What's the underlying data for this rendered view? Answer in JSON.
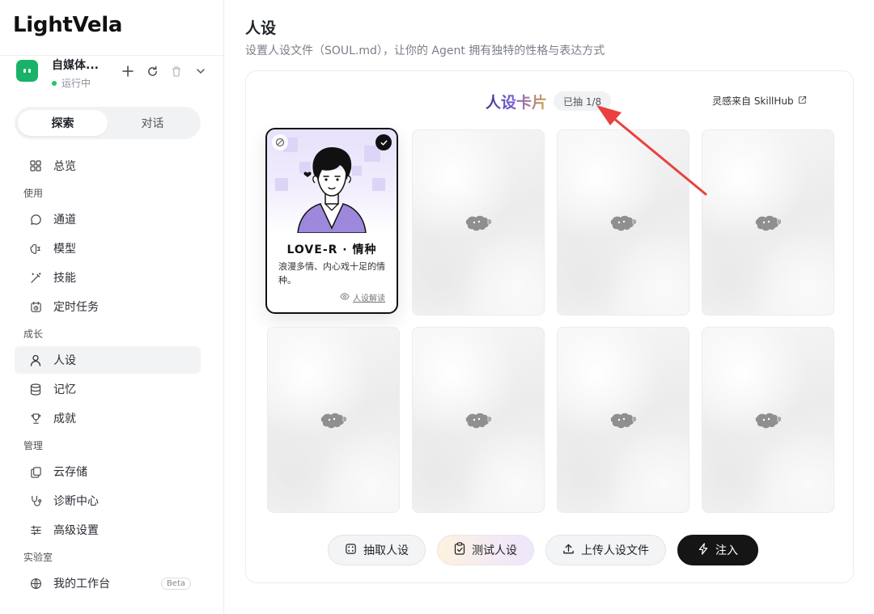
{
  "brand": {
    "name": "LightVela"
  },
  "agent": {
    "name": "自媒体...",
    "status": "运行中"
  },
  "sidebar": {
    "tabs": [
      {
        "label": "探索",
        "active": true
      },
      {
        "label": "对话",
        "active": false
      }
    ],
    "overview": {
      "label": "总览",
      "icon": "grid-icon"
    },
    "groups": [
      {
        "title": "使用",
        "items": [
          {
            "label": "通道",
            "icon": "chat-bubble-icon"
          },
          {
            "label": "模型",
            "icon": "brain-icon"
          },
          {
            "label": "技能",
            "icon": "magic-wand-icon"
          },
          {
            "label": "定时任务",
            "icon": "calendar-clock-icon"
          }
        ]
      },
      {
        "title": "成长",
        "items": [
          {
            "label": "人设",
            "icon": "person-icon",
            "active": true
          },
          {
            "label": "记忆",
            "icon": "database-icon"
          },
          {
            "label": "成就",
            "icon": "trophy-icon"
          }
        ]
      },
      {
        "title": "管理",
        "items": [
          {
            "label": "云存储",
            "icon": "cloud-storage-icon"
          },
          {
            "label": "诊断中心",
            "icon": "stethoscope-icon"
          },
          {
            "label": "高级设置",
            "icon": "sliders-icon"
          }
        ]
      },
      {
        "title": "实验室",
        "items": [
          {
            "label": "我的工作台",
            "icon": "globe-icon",
            "badge": "Beta"
          }
        ]
      }
    ]
  },
  "main": {
    "title": "人设",
    "subtitle": "设置人设文件（SOUL.md），让你的 Agent 拥有独特的性格与表达方式",
    "panel": {
      "card_title": "人设卡片",
      "drawn": "已抽 1/8",
      "inspiration": "灵感来自 SkillHub",
      "selected_card": {
        "name": "LOVE-R · 情种",
        "description": "浪漫多情、内心戏十足的情种。",
        "link": "人设解读"
      },
      "buttons": {
        "draw": "抽取人设",
        "test": "测试人设",
        "upload": "上传人设文件",
        "inject": "注入"
      }
    }
  },
  "colors": {
    "accent_green": "#18b368",
    "status_green": "#22c55e",
    "inject_button": "#151515",
    "arrow_red": "#e8413f"
  }
}
